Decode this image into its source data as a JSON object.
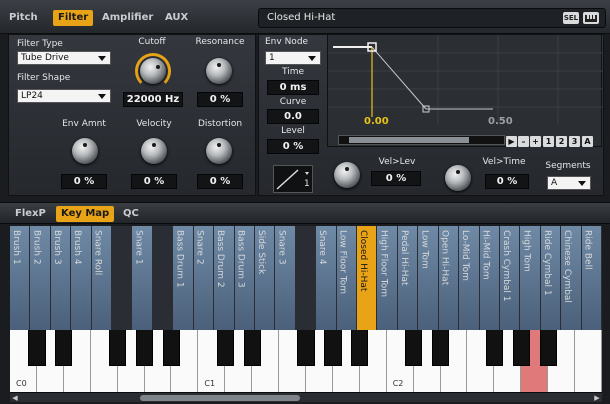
{
  "top_tabs": [
    "Pitch",
    "Filter",
    "Amplifier",
    "AUX"
  ],
  "active_top_tab": "Filter",
  "preset_name": "Closed Hi-Hat",
  "preset_buttons": [
    "SEL"
  ],
  "filter": {
    "type_label": "Filter Type",
    "type_value": "Tube Drive",
    "shape_label": "Filter Shape",
    "shape_value": "LP24",
    "cutoff_label": "Cutoff",
    "cutoff_value": "22000 Hz",
    "resonance_label": "Resonance",
    "resonance_value": "0 %",
    "env_amnt_label": "Env Amnt",
    "env_amnt_value": "0 %",
    "velocity_label": "Velocity",
    "velocity_value": "0 %",
    "distortion_label": "Distortion",
    "distortion_value": "0 %"
  },
  "env": {
    "node_label": "Env Node",
    "node_value": "1",
    "time_label": "Time",
    "time_value": "0 ms",
    "curve_label": "Curve",
    "curve_value": "0.0",
    "level_label": "Level",
    "level_value": "0 %",
    "curve_shape_num": "1",
    "vel_lev_label": "Vel>Lev",
    "vel_lev_value": "0 %",
    "vel_time_label": "Vel>Time",
    "vel_time_value": "0 %",
    "segments_label": "Segments",
    "segments_value": "A",
    "graph_ticks": [
      "0.00",
      "0.50"
    ],
    "scroll_buttons": [
      "▶",
      "–",
      "+",
      "1",
      "2",
      "3",
      "A"
    ]
  },
  "bottom_tabs": [
    "FlexP",
    "Key Map",
    "QC"
  ],
  "active_bottom_tab": "Key Map",
  "keymap_slots": [
    {
      "label": "Brush 1",
      "active": false
    },
    {
      "label": "Brush 2",
      "active": false
    },
    {
      "label": "Brush 3",
      "active": false
    },
    {
      "label": "Brush 4",
      "active": false
    },
    {
      "label": "Snare Roll",
      "active": false
    },
    {
      "label": "",
      "active": false
    },
    {
      "label": "Snare 1",
      "active": false
    },
    {
      "label": "",
      "active": false
    },
    {
      "label": "Bass Drum 1",
      "active": false
    },
    {
      "label": "Snare 2",
      "active": false
    },
    {
      "label": "Bass Drum 2",
      "active": false
    },
    {
      "label": "Bass Drum 3",
      "active": false
    },
    {
      "label": "Side Stick",
      "active": false
    },
    {
      "label": "Snare 3",
      "active": false
    },
    {
      "label": "",
      "active": false
    },
    {
      "label": "Snare 4",
      "active": false
    },
    {
      "label": "Low Floor Tom",
      "active": false
    },
    {
      "label": "Closed Hi-Hat",
      "active": true
    },
    {
      "label": "High Floor Tom",
      "active": false
    },
    {
      "label": "Pedal Hi-Hat",
      "active": false
    },
    {
      "label": "Low Tom",
      "active": false
    },
    {
      "label": "Open Hi-Hat",
      "active": false
    },
    {
      "label": "Lo-Mid Tom",
      "active": false
    },
    {
      "label": "Hi-Mid Tom",
      "active": false
    },
    {
      "label": "Crash Cymbal 1",
      "active": false
    },
    {
      "label": "High Tom",
      "active": false
    },
    {
      "label": "Ride Cymbal 1",
      "active": false
    },
    {
      "label": "Chinese Cymbal",
      "active": false
    },
    {
      "label": "Ride Bell",
      "active": false
    }
  ],
  "octave_labels": [
    "C0",
    "C1",
    "C2"
  ],
  "colors": {
    "accent": "#e8a317",
    "highlight_key": "#e07a7a",
    "panel": "#2e3137"
  }
}
